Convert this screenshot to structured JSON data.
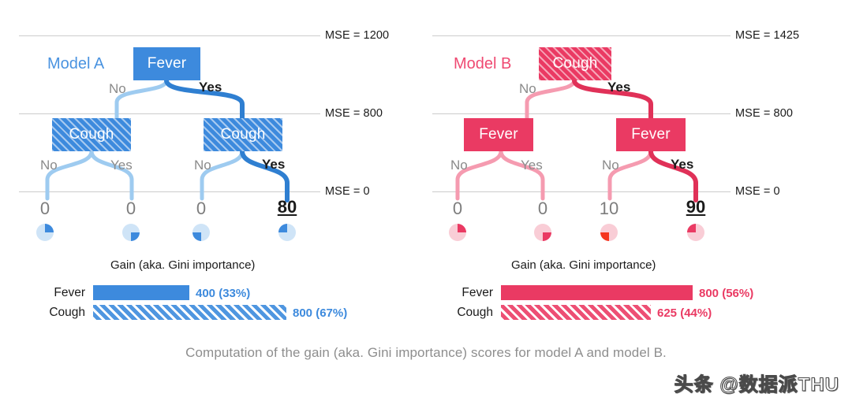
{
  "caption": "Computation of the gain (aka. Gini importance) scores for model A and model B.",
  "watermark": "头条 @数据派THU",
  "colors": {
    "model_a": "#3d8add",
    "model_a_light": "#9ecbf0",
    "model_b": "#ea3a63",
    "model_b_light": "#f59bb0",
    "model_b_accent": "#f5361f",
    "gridline": "#cccccc",
    "dim_text": "#8a8a8a",
    "caption_text": "#8e8e8e"
  },
  "mse_axis": {
    "left": [
      {
        "label": "MSE = 1200"
      },
      {
        "label": "MSE = 800"
      },
      {
        "label": "MSE = 0"
      }
    ],
    "right": [
      {
        "label": "MSE = 1425"
      },
      {
        "label": "MSE = 800"
      },
      {
        "label": "MSE = 0"
      }
    ]
  },
  "model_a": {
    "title": "Model A",
    "root": {
      "label": "Fever",
      "fill": "solid"
    },
    "children": [
      {
        "label": "Cough",
        "fill": "hatched"
      },
      {
        "label": "Cough",
        "fill": "hatched"
      }
    ],
    "branch_labels": {
      "root_no": "No",
      "root_yes": "Yes",
      "left_no": "No",
      "left_yes": "Yes",
      "right_no": "No",
      "right_yes": "Yes"
    },
    "leaves": [
      {
        "value": "0",
        "highlight": false,
        "pie_dark_quadrant": "top-right"
      },
      {
        "value": "0",
        "highlight": false,
        "pie_dark_quadrant": "bottom-right"
      },
      {
        "value": "0",
        "highlight": false,
        "pie_dark_quadrant": "bottom-left"
      },
      {
        "value": "80",
        "highlight": true,
        "pie_dark_quadrant": "top-left"
      }
    ],
    "gain": {
      "title": "Gain (aka. Gini importance)",
      "rows": [
        {
          "label": "Fever",
          "value": 400,
          "value_text": "400 (33%)",
          "percent": 33,
          "fill": "solid"
        },
        {
          "label": "Cough",
          "value": 800,
          "value_text": "800 (67%)",
          "percent": 67,
          "fill": "hatched"
        }
      ]
    }
  },
  "model_b": {
    "title": "Model B",
    "root": {
      "label": "Cough",
      "fill": "hatched"
    },
    "children": [
      {
        "label": "Fever",
        "fill": "solid"
      },
      {
        "label": "Fever",
        "fill": "solid"
      }
    ],
    "branch_labels": {
      "root_no": "No",
      "root_yes": "Yes",
      "left_no": "No",
      "left_yes": "Yes",
      "right_no": "No",
      "right_yes": "Yes"
    },
    "leaves": [
      {
        "value": "0",
        "highlight": false,
        "pie_dark_quadrant": "top-right"
      },
      {
        "value": "0",
        "highlight": false,
        "pie_dark_quadrant": "bottom-right"
      },
      {
        "value": "10",
        "highlight": false,
        "pie_dark_quadrant": "bottom-left"
      },
      {
        "value": "90",
        "highlight": true,
        "pie_dark_quadrant": "top-left"
      }
    ],
    "gain": {
      "title": "Gain (aka. Gini importance)",
      "rows": [
        {
          "label": "Fever",
          "value": 800,
          "value_text": "800 (56%)",
          "percent": 56,
          "fill": "solid"
        },
        {
          "label": "Cough",
          "value": 625,
          "value_text": "625 (44%)",
          "percent": 44,
          "fill": "hatched"
        }
      ]
    }
  },
  "chart_data": {
    "type": "bar",
    "title": "Gain (aka. Gini importance)",
    "charts": [
      {
        "name": "Model A gain",
        "categories": [
          "Fever",
          "Cough"
        ],
        "values": [
          400,
          800
        ],
        "percent": [
          33,
          67
        ],
        "color": "#3d8add"
      },
      {
        "name": "Model B gain",
        "categories": [
          "Fever",
          "Cough"
        ],
        "values": [
          800,
          625
        ],
        "percent": [
          56,
          44
        ],
        "color": "#ea3a63"
      }
    ],
    "tree_mse_levels_a": [
      1200,
      800,
      0
    ],
    "tree_mse_levels_b": [
      1425,
      800,
      0
    ],
    "leaf_values_a": [
      0,
      0,
      0,
      80
    ],
    "leaf_values_b": [
      0,
      0,
      10,
      90
    ],
    "xlabel": "",
    "ylabel": ""
  }
}
